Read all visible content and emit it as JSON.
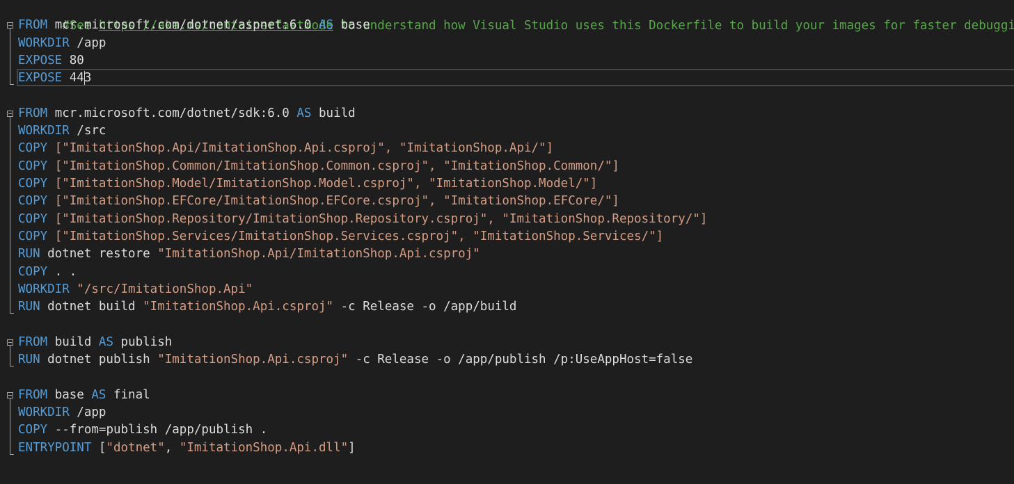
{
  "editor": {
    "comment": {
      "prefix": "#See ",
      "link": "https://aka.ms/containerfastmode",
      "suffix": " to understand how Visual Studio uses this Dockerfile to build your images for faster debugging."
    },
    "lines": [
      {
        "row": 2,
        "segments": [
          [
            "kw",
            "FROM"
          ],
          [
            "plain",
            " mcr.microsoft.com/dotnet/aspnet:6.0 "
          ],
          [
            "kw",
            "AS"
          ],
          [
            "plain",
            " base"
          ]
        ]
      },
      {
        "row": 3,
        "segments": [
          [
            "kw",
            "WORKDIR"
          ],
          [
            "plain",
            " /app"
          ]
        ]
      },
      {
        "row": 4,
        "segments": [
          [
            "kw",
            "EXPOSE"
          ],
          [
            "plain",
            " 80"
          ]
        ]
      },
      {
        "row": 5,
        "segments": [
          [
            "kw",
            "EXPOSE"
          ],
          [
            "plain",
            " 443"
          ]
        ]
      },
      {
        "row": 7,
        "segments": [
          [
            "kw",
            "FROM"
          ],
          [
            "plain",
            " mcr.microsoft.com/dotnet/sdk:6.0 "
          ],
          [
            "kw",
            "AS"
          ],
          [
            "plain",
            " build"
          ]
        ]
      },
      {
        "row": 8,
        "segments": [
          [
            "kw",
            "WORKDIR"
          ],
          [
            "plain",
            " /src"
          ]
        ]
      },
      {
        "row": 9,
        "segments": [
          [
            "kw",
            "COPY"
          ],
          [
            "str",
            " [\"ImitationShop.Api/ImitationShop.Api.csproj\", \"ImitationShop.Api/\"]"
          ]
        ]
      },
      {
        "row": 10,
        "segments": [
          [
            "kw",
            "COPY"
          ],
          [
            "str",
            " [\"ImitationShop.Common/ImitationShop.Common.csproj\", \"ImitationShop.Common/\"]"
          ]
        ]
      },
      {
        "row": 11,
        "segments": [
          [
            "kw",
            "COPY"
          ],
          [
            "str",
            " [\"ImitationShop.Model/ImitationShop.Model.csproj\", \"ImitationShop.Model/\"]"
          ]
        ]
      },
      {
        "row": 12,
        "segments": [
          [
            "kw",
            "COPY"
          ],
          [
            "str",
            " [\"ImitationShop.EFCore/ImitationShop.EFCore.csproj\", \"ImitationShop.EFCore/\"]"
          ]
        ]
      },
      {
        "row": 13,
        "segments": [
          [
            "kw",
            "COPY"
          ],
          [
            "str",
            " [\"ImitationShop.Repository/ImitationShop.Repository.csproj\", \"ImitationShop.Repository/\"]"
          ]
        ]
      },
      {
        "row": 14,
        "segments": [
          [
            "kw",
            "COPY"
          ],
          [
            "str",
            " [\"ImitationShop.Services/ImitationShop.Services.csproj\", \"ImitationShop.Services/\"]"
          ]
        ]
      },
      {
        "row": 15,
        "segments": [
          [
            "kw",
            "RUN"
          ],
          [
            "plain",
            " dotnet restore "
          ],
          [
            "str",
            "\"ImitationShop.Api/ImitationShop.Api.csproj\""
          ]
        ]
      },
      {
        "row": 16,
        "segments": [
          [
            "kw",
            "COPY"
          ],
          [
            "plain",
            " . ."
          ]
        ]
      },
      {
        "row": 17,
        "segments": [
          [
            "kw",
            "WORKDIR"
          ],
          [
            "str",
            " \"/src/ImitationShop.Api\""
          ]
        ]
      },
      {
        "row": 18,
        "segments": [
          [
            "kw",
            "RUN"
          ],
          [
            "plain",
            " dotnet build "
          ],
          [
            "str",
            "\"ImitationShop.Api.csproj\""
          ],
          [
            "plain",
            " -c Release -o /app/build"
          ]
        ]
      },
      {
        "row": 20,
        "segments": [
          [
            "kw",
            "FROM"
          ],
          [
            "plain",
            " build "
          ],
          [
            "kw",
            "AS"
          ],
          [
            "plain",
            " publish"
          ]
        ]
      },
      {
        "row": 21,
        "segments": [
          [
            "kw",
            "RUN"
          ],
          [
            "plain",
            " dotnet publish "
          ],
          [
            "str",
            "\"ImitationShop.Api.csproj\""
          ],
          [
            "plain",
            " -c Release -o /app/publish /p:UseAppHost=false"
          ]
        ]
      },
      {
        "row": 23,
        "segments": [
          [
            "kw",
            "FROM"
          ],
          [
            "plain",
            " base "
          ],
          [
            "kw",
            "AS"
          ],
          [
            "plain",
            " final"
          ]
        ]
      },
      {
        "row": 24,
        "segments": [
          [
            "kw",
            "WORKDIR"
          ],
          [
            "plain",
            " /app"
          ]
        ]
      },
      {
        "row": 25,
        "segments": [
          [
            "kw",
            "COPY"
          ],
          [
            "plain",
            " --from=publish /app/publish ."
          ]
        ]
      },
      {
        "row": 26,
        "segments": [
          [
            "kw",
            "ENTRYPOINT"
          ],
          [
            "plain",
            " ["
          ],
          [
            "str",
            "\"dotnet\""
          ],
          [
            "plain",
            ", "
          ],
          [
            "str",
            "\"ImitationShop.Api.dll\""
          ],
          [
            "plain",
            "]"
          ]
        ]
      }
    ],
    "fold_regions": [
      {
        "start": 2,
        "end": 5
      },
      {
        "start": 7,
        "end": 18
      },
      {
        "start": 20,
        "end": 21
      },
      {
        "start": 23,
        "end": 26
      }
    ],
    "colors": {
      "background": "#1e1e1e",
      "keyword": "#569cd6",
      "string": "#d69d85",
      "comment": "#57a64a",
      "text": "#dcdcdc"
    }
  }
}
